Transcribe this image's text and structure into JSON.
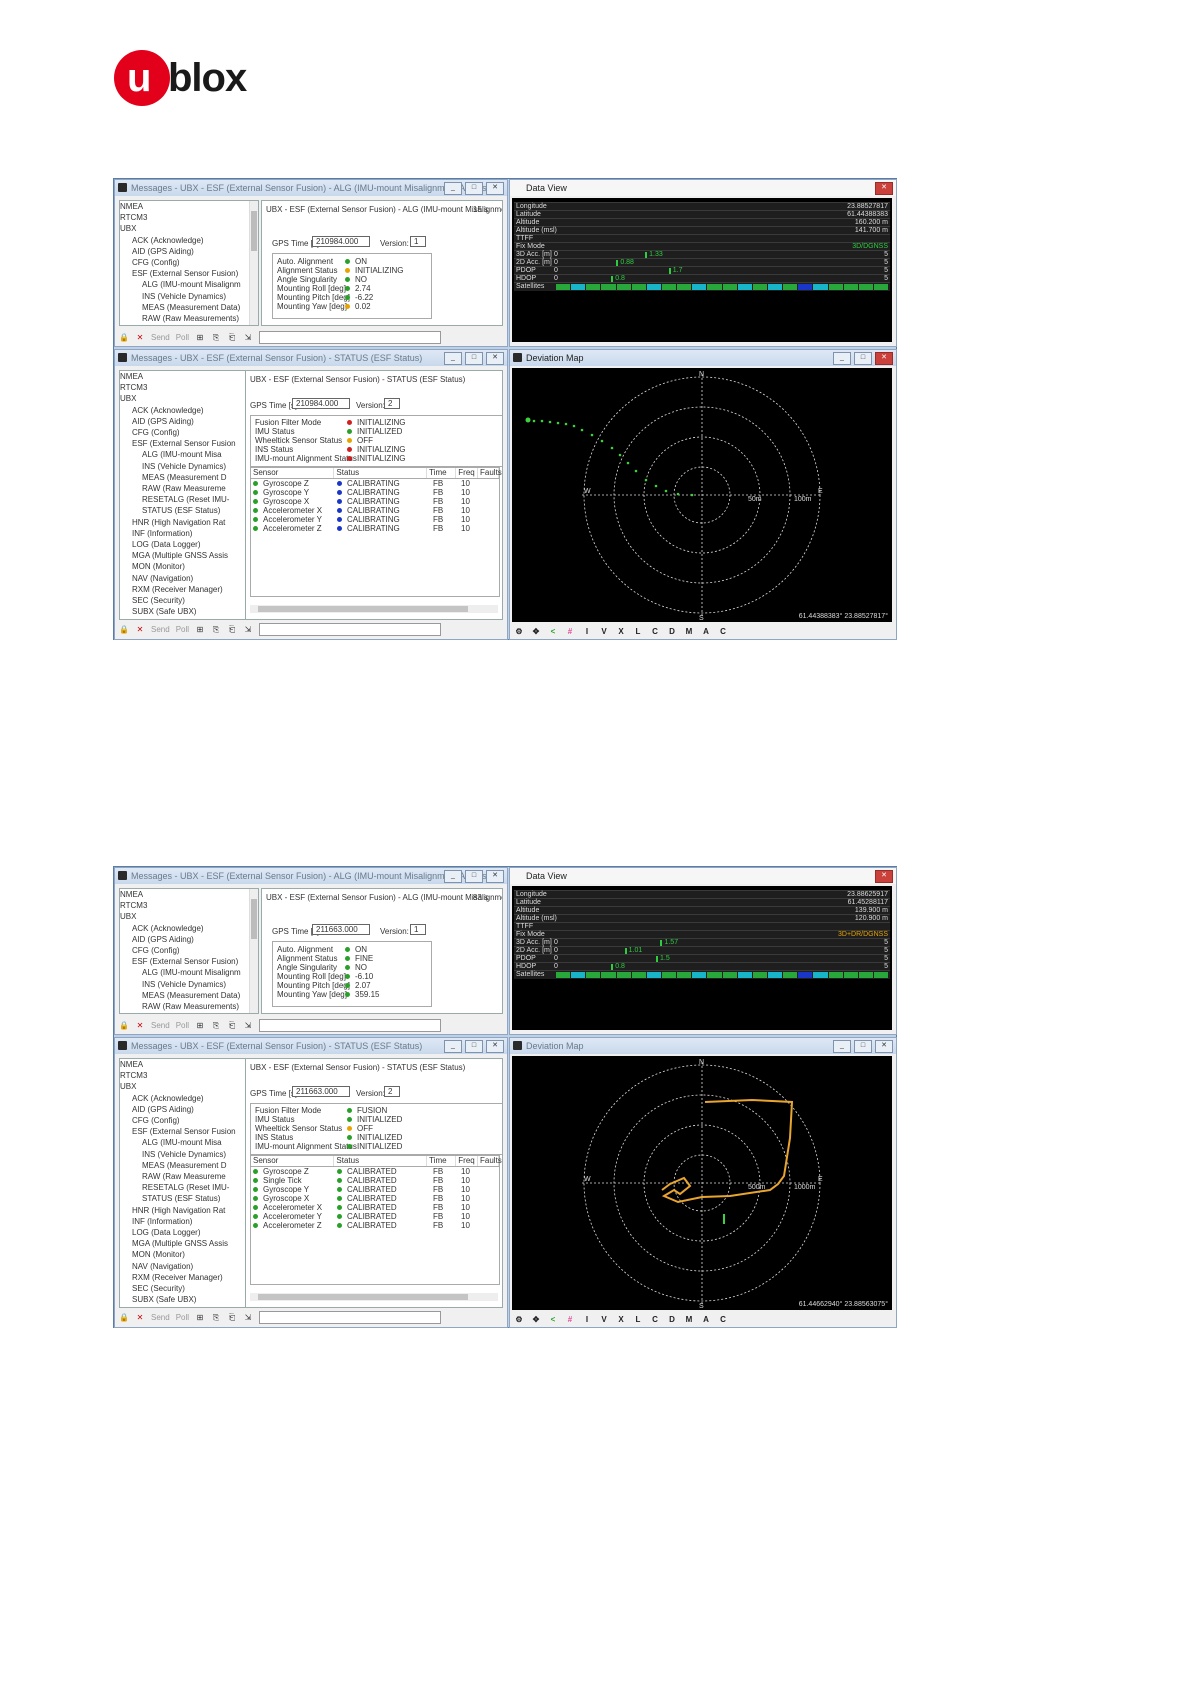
{
  "logo": {
    "text": "blox",
    "u": "u"
  },
  "screens": [
    {
      "alg_window": {
        "title": "Messages - UBX - ESF (External Sensor Fusion) - ALG (IMU-mount Misalignment Angles)",
        "tree": [
          "NMEA",
          "RTCM3",
          "UBX",
          "ACK (Acknowledge)",
          "AID (GPS Aiding)",
          "CFG (Config)",
          "ESF (External Sensor Fusion)",
          "ALG (IMU-mount Misalignm",
          "INS (Vehicle Dynamics)",
          "MEAS (Measurement Data)",
          "RAW (Raw Measurements)"
        ],
        "header": "UBX - ESF (External Sensor Fusion) - ALG (IMU-mount Misalignment ...",
        "age": "15 s",
        "gps_time_label": "GPS Time [s]:",
        "gps_time": "210984.000",
        "version_label": "Version:",
        "version": "1",
        "rows": [
          {
            "label": "Auto. Alignment",
            "status": "g",
            "value": "ON"
          },
          {
            "label": "Alignment Status",
            "status": "o",
            "value": "INITIALIZING"
          },
          {
            "label": "Angle Singularity",
            "status": "g",
            "value": "NO"
          },
          {
            "label": "Mounting Roll [deg]",
            "status": "g",
            "value": "2.74"
          },
          {
            "label": "Mounting Pitch [deg]",
            "status": "g",
            "value": "-6.22"
          },
          {
            "label": "Mounting Yaw [deg]",
            "status": "o",
            "value": "0.02"
          }
        ]
      },
      "data_view": {
        "title": "Data View",
        "rows": [
          {
            "label": "Longitude",
            "value": "23.88527817"
          },
          {
            "label": "Latitude",
            "value": "61.44388383"
          },
          {
            "label": "Altitude",
            "value": "160.200 m"
          },
          {
            "label": "Altitude (msl)",
            "value": "141.700 m"
          },
          {
            "label": "TTFF",
            "value": ""
          },
          {
            "label": "Fix Mode",
            "value": "3D/DGNSS"
          },
          {
            "label": "3D Acc. [m]",
            "value": "1.33",
            "min": "0",
            "max": "5"
          },
          {
            "label": "2D Acc. [m]",
            "value": "0.88",
            "min": "0",
            "max": "5"
          },
          {
            "label": "PDOP",
            "value": "1.7",
            "min": "0",
            "max": "5"
          },
          {
            "label": "HDOP",
            "value": "0.8",
            "min": "0",
            "max": "5"
          },
          {
            "label": "Satellites",
            "value": ""
          }
        ],
        "fix_color": "#2ecc40"
      },
      "status_window": {
        "title": "Messages - UBX - ESF (External Sensor Fusion) - STATUS (ESF Status)",
        "tree": [
          "NMEA",
          "RTCM3",
          "UBX",
          "ACK (Acknowledge)",
          "AID (GPS Aiding)",
          "CFG (Config)",
          "ESF (External Sensor Fusion",
          "ALG (IMU-mount Misa",
          "INS (Vehicle Dynamics)",
          "MEAS (Measurement D",
          "RAW (Raw Measureme",
          "RESETALG (Reset IMU-",
          "STATUS (ESF Status)",
          "HNR (High Navigation Rat",
          "INF (Information)",
          "LOG (Data Logger)",
          "MGA (Multiple GNSS Assis",
          "MON (Monitor)",
          "NAV (Navigation)",
          "RXM (Receiver Manager)",
          "SEC (Security)",
          "SUBX (Safe UBX)"
        ],
        "header": "UBX - ESF (External Sensor Fusion) - STATUS (ESF Status)",
        "gps_time_label": "GPS Time [s]:",
        "gps_time": "210984.000",
        "version_label": "Version:",
        "version": "2",
        "rows": [
          {
            "label": "Fusion Filter Mode",
            "status": "r",
            "value": "INITIALIZING"
          },
          {
            "label": "IMU Status",
            "status": "g",
            "value": "INITIALIZED"
          },
          {
            "label": "Wheeltick Sensor Status",
            "status": "o",
            "value": "OFF"
          },
          {
            "label": "INS Status",
            "status": "r",
            "value": "INITIALIZING"
          },
          {
            "label": "IMU-mount Alignment Status",
            "status": "r",
            "value": "INITIALIZING"
          }
        ],
        "sensor_headers": [
          "Sensor",
          "Status",
          "Time",
          "Freq",
          "Faults"
        ],
        "sensors": [
          {
            "name": "Gyroscope Z",
            "status": "CALIBRATING",
            "time": "FB",
            "freq": "10",
            "c": "b"
          },
          {
            "name": "Gyroscope Y",
            "status": "CALIBRATING",
            "time": "FB",
            "freq": "10",
            "c": "b"
          },
          {
            "name": "Gyroscope X",
            "status": "CALIBRATING",
            "time": "FB",
            "freq": "10",
            "c": "b"
          },
          {
            "name": "Accelerometer X",
            "status": "CALIBRATING",
            "time": "FB",
            "freq": "10",
            "c": "b"
          },
          {
            "name": "Accelerometer Y",
            "status": "CALIBRATING",
            "time": "FB",
            "freq": "10",
            "c": "b"
          },
          {
            "name": "Accelerometer Z",
            "status": "CALIBRATING",
            "time": "FB",
            "freq": "10",
            "c": "b"
          }
        ]
      },
      "deviation_map": {
        "title": "Deviation Map",
        "n": "N",
        "s": "S",
        "e": "E",
        "w": "W",
        "ring1": "50m",
        "ring2": "100m",
        "coords": "61.44388383° 23.88527817°",
        "toolbar": [
          "I",
          "V",
          "X",
          "L",
          "C",
          "D",
          "M",
          "A",
          "C"
        ]
      }
    },
    {
      "alg_window": {
        "title": "Messages - UBX - ESF (External Sensor Fusion) - ALG (IMU-mount Misalignment Angles)",
        "tree": [
          "NMEA",
          "RTCM3",
          "UBX",
          "ACK (Acknowledge)",
          "AID (GPS Aiding)",
          "CFG (Config)",
          "ESF (External Sensor Fusion)",
          "ALG (IMU-mount Misalignm",
          "INS (Vehicle Dynamics)",
          "MEAS (Measurement Data)",
          "RAW (Raw Measurements)"
        ],
        "header": "UBX - ESF (External Sensor Fusion) - ALG (IMU-mount Misalignment ...",
        "age": "83 s",
        "gps_time_label": "GPS Time [s]:",
        "gps_time": "211663.000",
        "version_label": "Version:",
        "version": "1",
        "rows": [
          {
            "label": "Auto. Alignment",
            "status": "g",
            "value": "ON"
          },
          {
            "label": "Alignment Status",
            "status": "g",
            "value": "FINE"
          },
          {
            "label": "Angle Singularity",
            "status": "g",
            "value": "NO"
          },
          {
            "label": "Mounting Roll [deg]",
            "status": "g",
            "value": "-6.10"
          },
          {
            "label": "Mounting Pitch [deg]",
            "status": "g",
            "value": "2.07"
          },
          {
            "label": "Mounting Yaw [deg]",
            "status": "g",
            "value": "359.15"
          }
        ]
      },
      "data_view": {
        "title": "Data View",
        "rows": [
          {
            "label": "Longitude",
            "value": "23.88625917"
          },
          {
            "label": "Latitude",
            "value": "61.45288117"
          },
          {
            "label": "Altitude",
            "value": "139.900 m"
          },
          {
            "label": "Altitude (msl)",
            "value": "120.900 m"
          },
          {
            "label": "TTFF",
            "value": ""
          },
          {
            "label": "Fix Mode",
            "value": "3D+DR/DGNSS"
          },
          {
            "label": "3D Acc. [m]",
            "value": "1.57",
            "min": "0",
            "max": "5"
          },
          {
            "label": "2D Acc. [m]",
            "value": "1.01",
            "min": "0",
            "max": "5"
          },
          {
            "label": "PDOP",
            "value": "1.5",
            "min": "0",
            "max": "5"
          },
          {
            "label": "HDOP",
            "value": "0.8",
            "min": "0",
            "max": "5"
          },
          {
            "label": "Satellites",
            "value": ""
          }
        ],
        "fix_color": "#e7a400"
      },
      "status_window": {
        "title": "Messages - UBX - ESF (External Sensor Fusion) - STATUS (ESF Status)",
        "tree": [
          "NMEA",
          "RTCM3",
          "UBX",
          "ACK (Acknowledge)",
          "AID (GPS Aiding)",
          "CFG (Config)",
          "ESF (External Sensor Fusion",
          "ALG (IMU-mount Misa",
          "INS (Vehicle Dynamics)",
          "MEAS (Measurement D",
          "RAW (Raw Measureme",
          "RESETALG (Reset IMU-",
          "STATUS (ESF Status)",
          "HNR (High Navigation Rat",
          "INF (Information)",
          "LOG (Data Logger)",
          "MGA (Multiple GNSS Assis",
          "MON (Monitor)",
          "NAV (Navigation)",
          "RXM (Receiver Manager)",
          "SEC (Security)",
          "SUBX (Safe UBX)"
        ],
        "header": "UBX - ESF (External Sensor Fusion) - STATUS (ESF Status)",
        "gps_time_label": "GPS Time [s]:",
        "gps_time": "211663.000",
        "version_label": "Version:",
        "version": "2",
        "rows": [
          {
            "label": "Fusion Filter Mode",
            "status": "g",
            "value": "FUSION"
          },
          {
            "label": "IMU Status",
            "status": "g",
            "value": "INITIALIZED"
          },
          {
            "label": "Wheeltick Sensor Status",
            "status": "o",
            "value": "OFF"
          },
          {
            "label": "INS Status",
            "status": "g",
            "value": "INITIALIZED"
          },
          {
            "label": "IMU-mount Alignment Status",
            "status": "g",
            "value": "INITIALIZED"
          }
        ],
        "sensor_headers": [
          "Sensor",
          "Status",
          "Time",
          "Freq",
          "Faults"
        ],
        "sensors": [
          {
            "name": "Gyroscope Z",
            "status": "CALIBRATED",
            "time": "FB",
            "freq": "10",
            "c": "g"
          },
          {
            "name": "Single Tick",
            "status": "CALIBRATED",
            "time": "FB",
            "freq": "10",
            "c": "g"
          },
          {
            "name": "Gyroscope Y",
            "status": "CALIBRATED",
            "time": "FB",
            "freq": "10",
            "c": "g"
          },
          {
            "name": "Gyroscope X",
            "status": "CALIBRATED",
            "time": "FB",
            "freq": "10",
            "c": "g"
          },
          {
            "name": "Accelerometer X",
            "status": "CALIBRATED",
            "time": "FB",
            "freq": "10",
            "c": "g"
          },
          {
            "name": "Accelerometer Y",
            "status": "CALIBRATED",
            "time": "FB",
            "freq": "10",
            "c": "g"
          },
          {
            "name": "Accelerometer Z",
            "status": "CALIBRATED",
            "time": "FB",
            "freq": "10",
            "c": "g"
          }
        ]
      },
      "deviation_map": {
        "title": "Deviation Map",
        "n": "N",
        "s": "S",
        "e": "E",
        "w": "W",
        "ring1": "500m",
        "ring2": "1000m",
        "coords": "61.44662940° 23.88563075°",
        "toolbar": [
          "I",
          "V",
          "X",
          "L",
          "C",
          "D",
          "M",
          "A",
          "C"
        ]
      }
    }
  ],
  "toolbar_labels": {
    "send": "Send",
    "poll": "Poll"
  }
}
